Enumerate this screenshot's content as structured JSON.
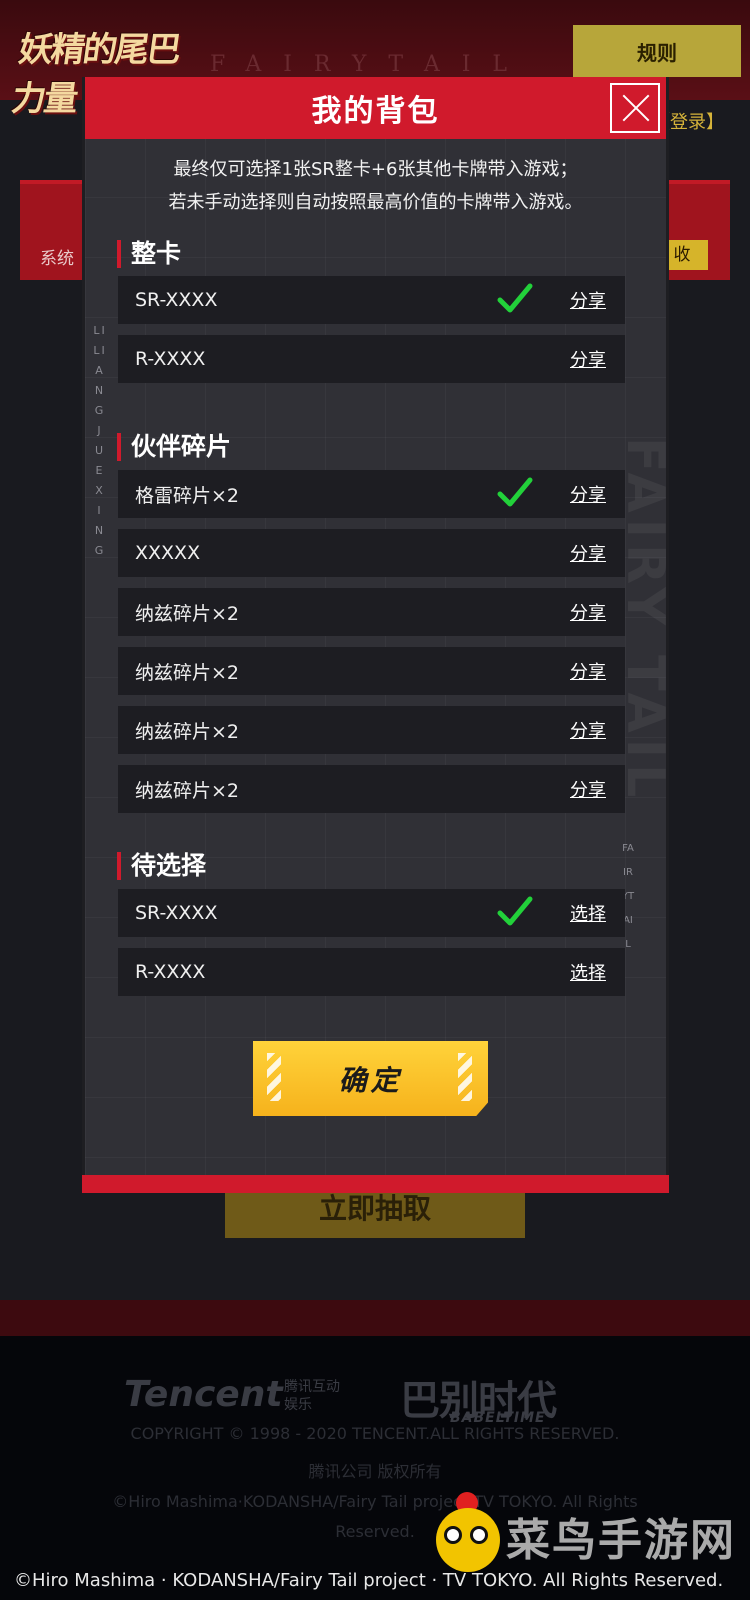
{
  "background": {
    "logo_text": "妖精的尾巴 力量",
    "top_watermark": "FAIRYTAIL",
    "rule_button": "规则",
    "login_link": "【登录】",
    "system_label": "系统",
    "tag_label": "收",
    "collect_button": "立即抽取"
  },
  "modal": {
    "title": "我的背包",
    "notice_line1": "最终仅可选择1张SR整卡+6张其他卡牌带入游戏；",
    "notice_line2": "若未手动选择则自动按照最高价值的卡牌带入游戏。",
    "side_text_left": "LILIANGJUEXING",
    "side_text_right": "FAIRYTAIL",
    "big_watermark": "FAIRY TAIL",
    "sections": [
      {
        "title": "整卡",
        "rows": [
          {
            "label": "SR-XXXX",
            "action": "分享",
            "checked": true
          },
          {
            "label": "R-XXXX",
            "action": "分享",
            "checked": false
          }
        ]
      },
      {
        "title": "伙伴碎片",
        "rows": [
          {
            "label": "格雷碎片×2",
            "action": "分享",
            "checked": true
          },
          {
            "label": "XXXXX",
            "action": "分享",
            "checked": false
          },
          {
            "label": "纳兹碎片×2",
            "action": "分享",
            "checked": false
          },
          {
            "label": "纳兹碎片×2",
            "action": "分享",
            "checked": false
          },
          {
            "label": "纳兹碎片×2",
            "action": "分享",
            "checked": false
          },
          {
            "label": "纳兹碎片×2",
            "action": "分享",
            "checked": false
          }
        ]
      },
      {
        "title": "待选择",
        "rows": [
          {
            "label": "SR-XXXX",
            "action": "选择",
            "checked": true
          },
          {
            "label": "R-XXXX",
            "action": "选择",
            "checked": false
          }
        ]
      }
    ],
    "confirm_button": "确定"
  },
  "footer": {
    "tencent_logo": "Tencent",
    "tencent_cn": "腾讯互动娱乐",
    "babel_logo": "巴别时代",
    "babel_sub": "BABELTIME",
    "copyright": "COPYRIGHT © 1998 - 2020 TENCENT.ALL RIGHTS RESERVED.",
    "copyright_cn": "腾讯公司 版权所有",
    "license_line1": "©Hiro Mashima·KODANSHA/Fairy Tail project·TV TOKYO. All Rights",
    "license_line2": "Reserved.",
    "credit": "©Hiro Mashima · KODANSHA/Fairy Tail project · TV TOKYO. All Rights Reserved."
  },
  "watermark": {
    "site_name": "菜鸟手游网"
  },
  "colors": {
    "accent_red": "#d01a2c",
    "check_green": "#22d13a",
    "confirm_yellow": "#f6b21c"
  }
}
